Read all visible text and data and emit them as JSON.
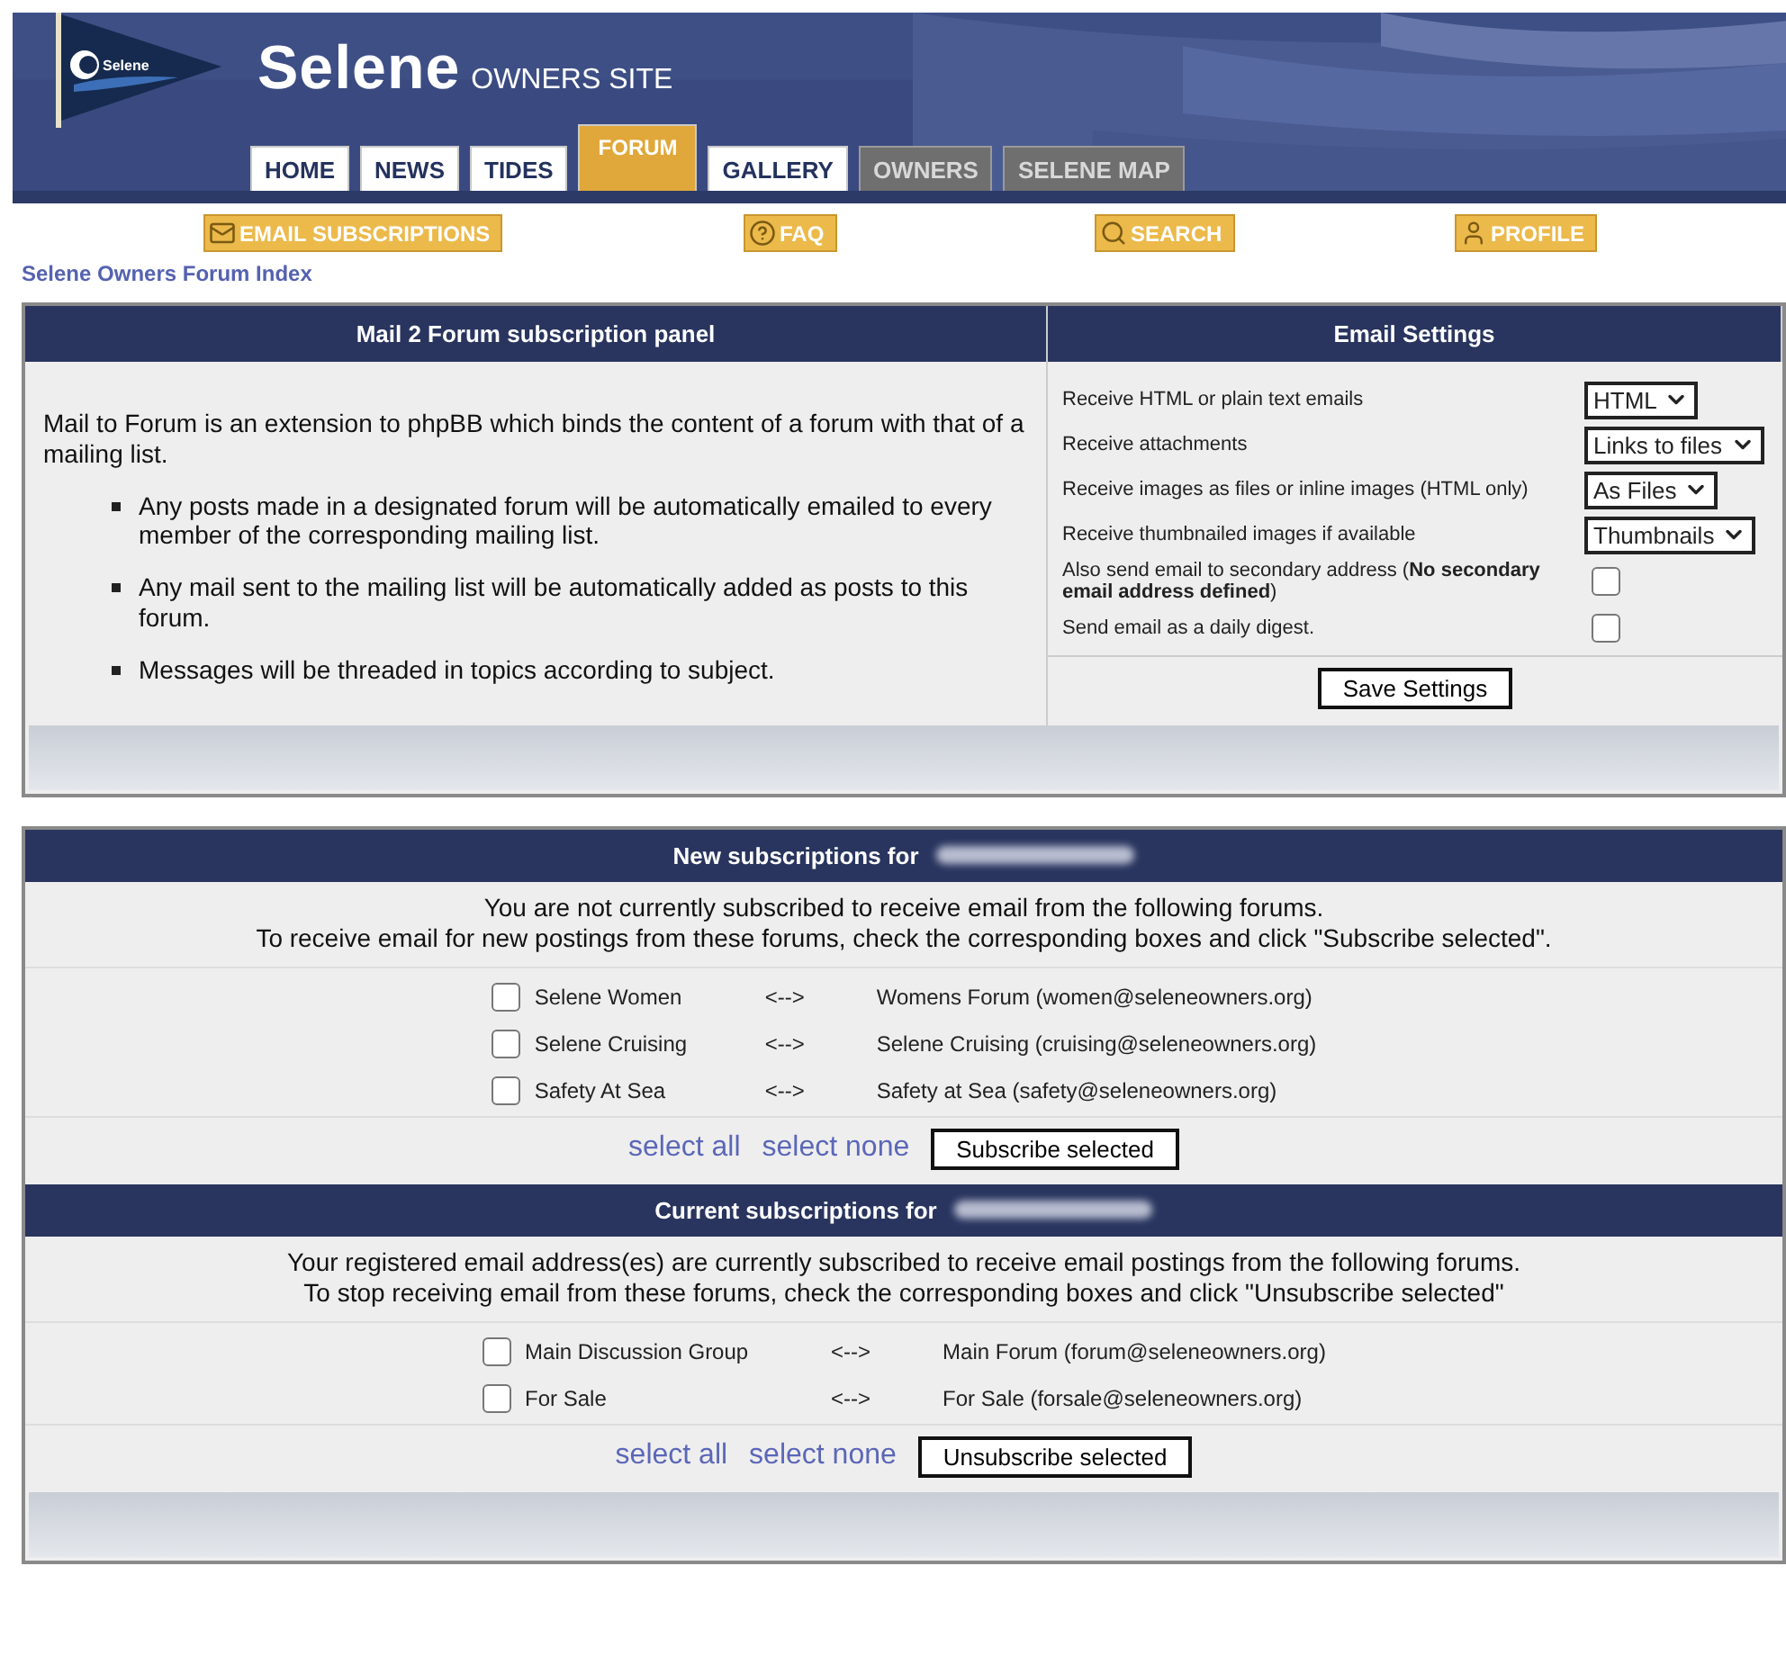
{
  "header": {
    "logo_text": "Selene",
    "site_name": "Selene",
    "site_tagline": "OWNERS SITE"
  },
  "tabs": [
    {
      "label": "HOME",
      "selected": false,
      "disabled": false
    },
    {
      "label": "NEWS",
      "selected": false,
      "disabled": false
    },
    {
      "label": "TIDES",
      "selected": false,
      "disabled": false
    },
    {
      "label": "FORUM",
      "selected": true,
      "disabled": false
    },
    {
      "label": "GALLERY",
      "selected": false,
      "disabled": false
    },
    {
      "label": "OWNERS",
      "selected": false,
      "disabled": true
    },
    {
      "label": "SELENE MAP",
      "selected": false,
      "disabled": true
    }
  ],
  "toolbar": [
    {
      "label": "EMAIL SUBSCRIPTIONS",
      "kind": "mail"
    },
    {
      "label": "FAQ",
      "kind": "faq"
    },
    {
      "label": "SEARCH",
      "kind": "search"
    },
    {
      "label": "PROFILE",
      "kind": "profile"
    }
  ],
  "breadcrumb": "Selene Owners Forum Index",
  "panel": {
    "title": "Mail 2 Forum subscription panel",
    "intro": "Mail to Forum is an extension to phpBB which binds the content of a forum with that of a mailing list.",
    "bullets": [
      "Any posts made in a designated forum will be automatically emailed to every member of the corresponding mailing list.",
      "Any mail sent to the mailing list will be automatically added as posts to this forum.",
      "Messages will be threaded in topics according to subject."
    ]
  },
  "email_settings": {
    "title": "Email Settings",
    "rows": [
      {
        "kind": "select",
        "label": "Receive HTML or plain text emails",
        "value": "HTML"
      },
      {
        "kind": "select",
        "label": "Receive attachments",
        "value": "Links to files"
      },
      {
        "kind": "select",
        "label": "Receive images as files or inline images (HTML only)",
        "value": "As Files"
      },
      {
        "kind": "select",
        "label": "Receive thumbnailed images if available",
        "value": "Thumbnails"
      },
      {
        "kind": "checkbox",
        "label": "Also send email to secondary address (**No secondary email address defined**)",
        "checked": false
      },
      {
        "kind": "checkbox",
        "label": "Send email as a daily digest.",
        "checked": false
      }
    ],
    "save_button": "Save Settings"
  },
  "sections": [
    {
      "title": "New subscriptions for",
      "note": [
        "You are not currently subscribed to receive email from the following forums.",
        "To receive email for new postings from these forums, check the corresponding boxes and click \"Subscribe selected\"."
      ],
      "forums": [
        {
          "name": "Selene Women",
          "arrow": "<-->",
          "list": "Womens Forum (women@seleneowners.org)",
          "checked": false
        },
        {
          "name": "Selene Cruising",
          "arrow": "<-->",
          "list": "Selene Cruising (cruising@seleneowners.org)",
          "checked": false
        },
        {
          "name": "Safety At Sea",
          "arrow": "<-->",
          "list": "Safety at Sea (safety@seleneowners.org)",
          "checked": false
        }
      ],
      "select_all": "select all",
      "select_none": "select none",
      "button": "Subscribe selected"
    },
    {
      "title": "Current subscriptions for",
      "note": [
        "Your registered email address(es) are currently subscribed to receive email postings from the following forums.",
        "To stop receiving email from these forums, check the corresponding boxes and click \"Unsubscribe selected\""
      ],
      "forums": [
        {
          "name": "Main Discussion Group",
          "arrow": "<-->",
          "list": "Main Forum (forum@seleneowners.org)",
          "checked": false
        },
        {
          "name": "For Sale",
          "arrow": "<-->",
          "list": "For Sale (forsale@seleneowners.org)",
          "checked": false
        }
      ],
      "select_all": "select all",
      "select_none": "select none",
      "button": "Unsubscribe selected"
    }
  ]
}
